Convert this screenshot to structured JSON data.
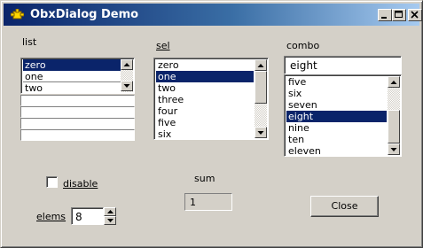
{
  "window": {
    "title": "ObxDialog Demo"
  },
  "list": {
    "label": "list",
    "items": [
      "zero",
      "one",
      "two"
    ],
    "selected_index": 0
  },
  "sel": {
    "label": "sel",
    "items": [
      "zero",
      "one",
      "two",
      "three",
      "four",
      "five",
      "six"
    ],
    "selected_index": 1
  },
  "combo": {
    "label": "combo",
    "value": "eight",
    "items": [
      "five",
      "six",
      "seven",
      "eight",
      "nine",
      "ten",
      "eleven"
    ],
    "selected_index": 3
  },
  "disable": {
    "label": "disable",
    "checked": false
  },
  "sum": {
    "label": "sum",
    "value": "1"
  },
  "elems": {
    "label": "elems",
    "value": "8"
  },
  "close_button": {
    "label": "Close"
  }
}
